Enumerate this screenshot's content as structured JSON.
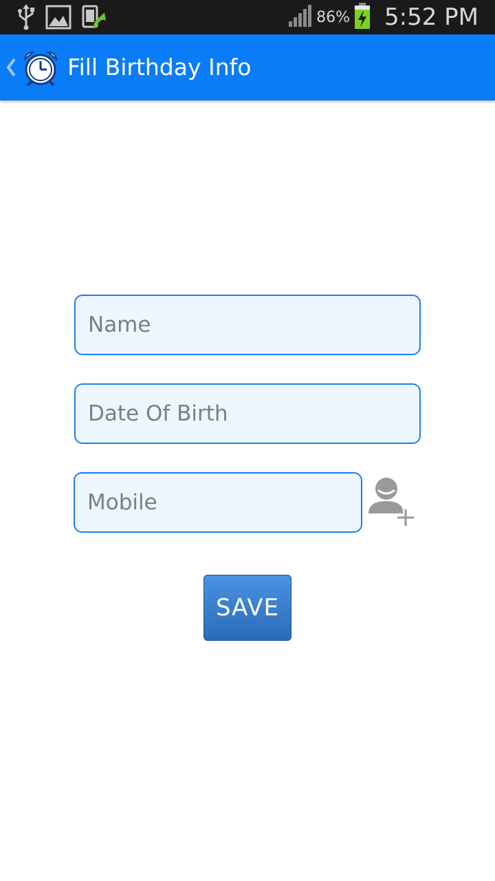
{
  "status_bar": {
    "battery_percent": "86%",
    "time": "5:52 PM",
    "icons": [
      "usb-icon",
      "image-icon",
      "update-icon",
      "signal-icon",
      "battery-charging-icon"
    ]
  },
  "action_bar": {
    "title": "Fill Birthday Info",
    "back_icon": "chevron-left-icon",
    "app_icon": "alarm-clock-icon",
    "color": "#0a7cf7"
  },
  "form": {
    "name_placeholder": "Name",
    "dob_placeholder": "Date Of Birth",
    "mobile_placeholder": "Mobile",
    "add_contact_icon": "add-contact-icon",
    "save_label": "SAVE"
  }
}
